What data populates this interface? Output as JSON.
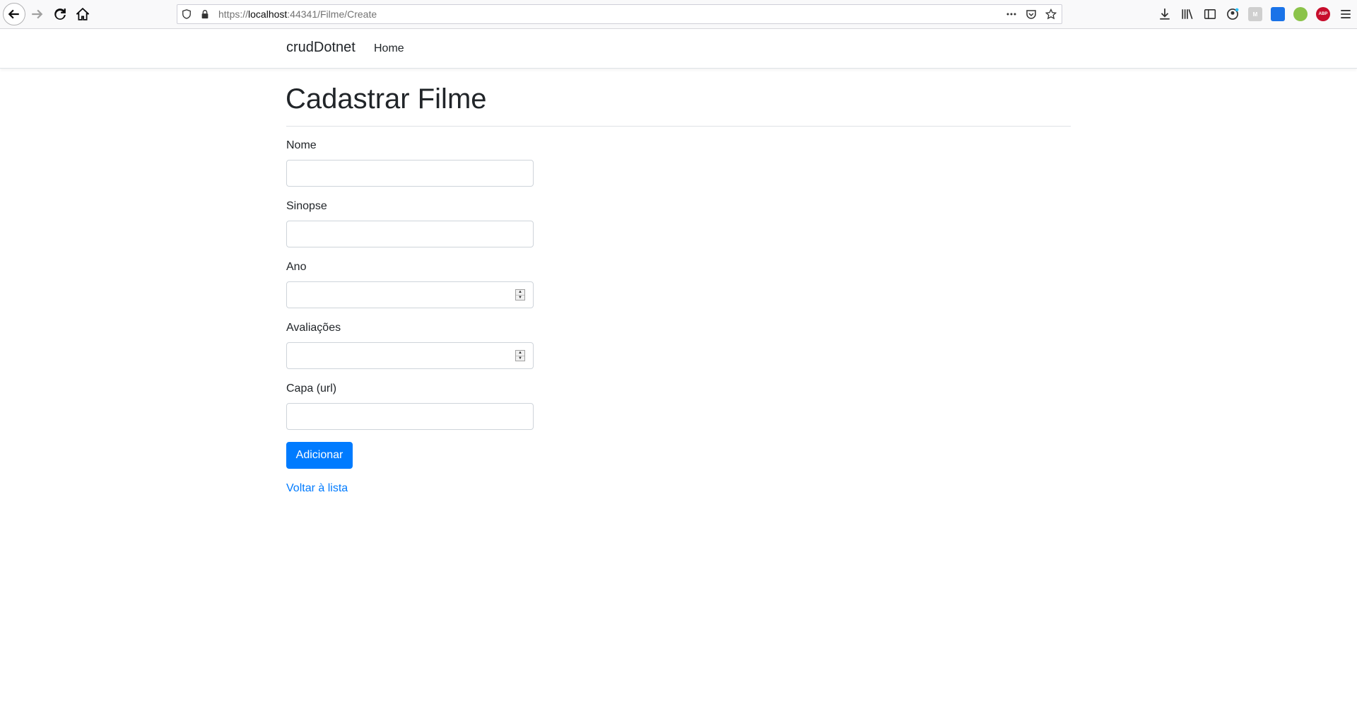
{
  "browser": {
    "url_prefix": "https://",
    "url_host": "localhost",
    "url_rest": ":44341/Filme/Create",
    "extensions": [
      "M",
      "ABP"
    ]
  },
  "navbar": {
    "brand": "crudDotnet",
    "links": [
      "Home"
    ]
  },
  "page": {
    "title": "Cadastrar Filme"
  },
  "form": {
    "fields": [
      {
        "label": "Nome",
        "type": "text",
        "value": ""
      },
      {
        "label": "Sinopse",
        "type": "text",
        "value": ""
      },
      {
        "label": "Ano",
        "type": "number",
        "value": ""
      },
      {
        "label": "Avaliações",
        "type": "number",
        "value": ""
      },
      {
        "label": "Capa (url)",
        "type": "text",
        "value": ""
      }
    ],
    "submit_label": "Adicionar",
    "back_link": "Voltar à lista"
  },
  "colors": {
    "primary": "#007bff",
    "text": "#212529",
    "border": "#ced4da"
  }
}
